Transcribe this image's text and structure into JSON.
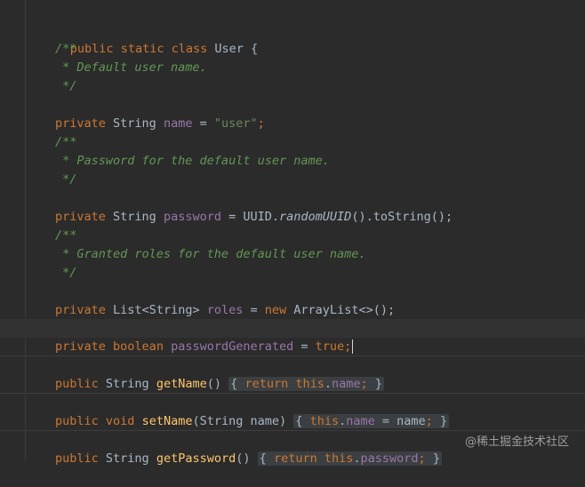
{
  "lines": {
    "l0": [
      "public",
      " ",
      "static",
      " ",
      "class",
      " ",
      "User",
      " {"
    ],
    "l1": "/**",
    "l2": " * Default user name.",
    "l3": " */",
    "l4": [
      "private",
      " ",
      "String",
      " ",
      "name",
      " = ",
      "\"user\"",
      ";"
    ],
    "l5": "/**",
    "l6": " * Password for the default user name.",
    "l7": " */",
    "l8": [
      "private",
      " ",
      "String",
      " ",
      "password",
      " = ",
      "UUID.",
      "randomUUID",
      "().toString();"
    ],
    "l9": "/**",
    "l10": " * Granted roles for the default user name.",
    "l11": " */",
    "l12": [
      "private",
      " ",
      "List<String>",
      " ",
      "roles",
      " = ",
      "new",
      " ",
      "ArrayList<>();"
    ],
    "l13": [
      "private",
      " ",
      "boolean",
      " ",
      "passwordGenerated",
      " = ",
      "true",
      ";"
    ],
    "l14": [
      "public",
      " ",
      "String",
      " ",
      "getName",
      "()",
      " ",
      "{",
      " ",
      "return",
      " ",
      "this",
      ".",
      "name",
      ";",
      " ",
      "}"
    ],
    "l15": [
      "public",
      " ",
      "void",
      " ",
      "setName",
      "(String name)",
      " ",
      "{",
      " ",
      "this",
      ".",
      "name",
      " = name",
      ";",
      " ",
      "}"
    ],
    "l16": [
      "public",
      " ",
      "String",
      " ",
      "getPassword",
      "()",
      " ",
      "{",
      " ",
      "return",
      " ",
      "this",
      ".",
      "password",
      ";",
      " ",
      "}"
    ]
  },
  "watermark": "@稀土掘金技术社区",
  "colors": {
    "background": "#2b2b2b",
    "keyword": "#cc7832",
    "field": "#9876aa",
    "string": "#6a8759",
    "comment": "#629755",
    "method": "#ffc66d",
    "text": "#a9b7c6"
  }
}
